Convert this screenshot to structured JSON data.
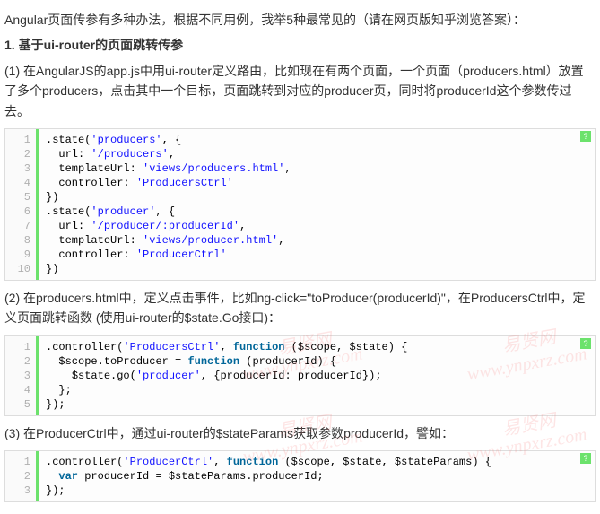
{
  "intro": "Angular页面传参有多种办法，根据不同用例，我举5种最常见的（请在网页版知乎浏览答案）：",
  "heading1": "1. 基于ui-router的页面跳转传参",
  "para1": "(1) 在AngularJS的app.js中用ui-router定义路由，比如现在有两个页面，一个页面（producers.html）放置了多个producers，点击其中一个目标，页面跳转到对应的producer页，同时将producerId这个参数传过去。",
  "code1_lines": [
    ".state('producers', {",
    "  url: '/producers',",
    "  templateUrl: 'views/producers.html',",
    "  controller: 'ProducersCtrl'",
    "})",
    ".state('producer', {",
    "  url: '/producer/:producerId',",
    "  templateUrl: 'views/producer.html',",
    "  controller: 'ProducerCtrl'",
    "})"
  ],
  "para2": "(2) 在producers.html中，定义点击事件，比如ng-click=\"toProducer(producerId)\"，在ProducersCtrl中，定义页面跳转函数 (使用ui-router的$state.Go接口)：",
  "code2_lines": [
    ".controller('ProducersCtrl', function ($scope, $state) {",
    "  $scope.toProducer = function (producerId) {",
    "    $state.go('producer', {producerId: producerId});",
    "  };",
    "});"
  ],
  "para3": "(3) 在ProducerCtrl中，通过ui-router的$stateParams获取参数producerId，譬如：",
  "code3_lines": [
    ".controller('ProducerCtrl', function ($scope, $state, $stateParams) {",
    "  var producerId = $stateParams.producerId;",
    "});"
  ],
  "watermark_text": "易贤网",
  "watermark_url": "www.ynpxrz.com",
  "qm_label": "?"
}
